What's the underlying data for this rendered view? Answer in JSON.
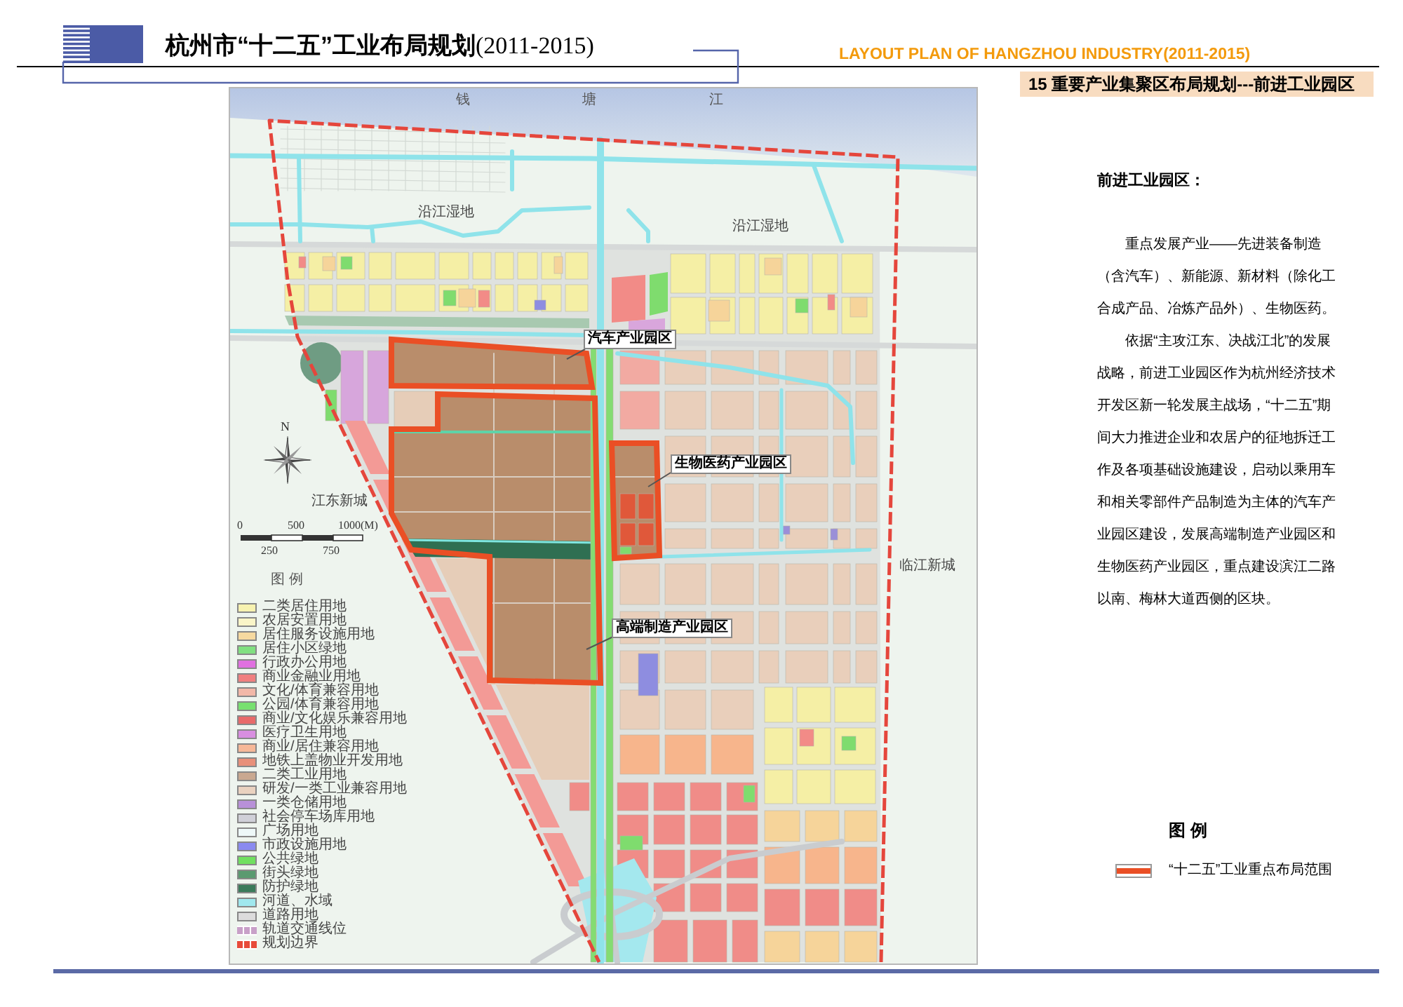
{
  "header": {
    "title": "杭州市“十二五”工业布局规划",
    "title_period": "(2011-2015)",
    "english_title": "LAYOUT PLAN OF HANGZHOU INDUSTRY(2011-2015)",
    "section_title": "15 重要产业集聚区布局规划---前进工业园区"
  },
  "map": {
    "river_label": "钱 塘 江",
    "area_labels": [
      {
        "text": "沿江湿地"
      },
      {
        "text": "沿江湿地"
      },
      {
        "text": "江东新城"
      },
      {
        "text": "临江新城"
      }
    ],
    "park_labels": [
      "汽车产业园区",
      "生物医药产业园区",
      "高端制造产业园区"
    ],
    "compass": {
      "north_label": "N"
    },
    "scale_bar": {
      "top_labels": [
        "0",
        "500",
        "1000(M)"
      ],
      "bottom_labels": [
        "250",
        "750"
      ]
    },
    "legend": {
      "title": "图 例",
      "items": [
        {
          "label": "二类居住用地",
          "kind": "fill",
          "color": "#f7f2b0"
        },
        {
          "label": "农居安置用地",
          "kind": "fill",
          "color": "#faf5c8"
        },
        {
          "label": "居住服务设施用地",
          "kind": "fill",
          "color": "#f6d9a0"
        },
        {
          "label": "居住小区绿地",
          "kind": "fill",
          "color": "#80e080"
        },
        {
          "label": "行政办公用地",
          "kind": "fill",
          "color": "#e070e0"
        },
        {
          "label": "商业金融业用地",
          "kind": "fill",
          "color": "#f07f7f"
        },
        {
          "label": "文化/体育兼容用地",
          "kind": "fill",
          "color": "#f2b8a8"
        },
        {
          "label": "公园/体育兼容用地",
          "kind": "fill",
          "color": "#78e070"
        },
        {
          "label": "商业/文化娱乐兼容用地",
          "kind": "fill",
          "color": "#e86a6a"
        },
        {
          "label": "医疗卫生用地",
          "kind": "fill",
          "color": "#d88ee0"
        },
        {
          "label": "商业/居住兼容用地",
          "kind": "fill",
          "color": "#f6b898"
        },
        {
          "label": "地铁上盖物业开发用地",
          "kind": "fill",
          "color": "#e8907a"
        },
        {
          "label": "二类工业用地",
          "kind": "fill",
          "color": "#c9a890"
        },
        {
          "label": "研发/一类工业兼容用地",
          "kind": "fill",
          "color": "#ead2c0"
        },
        {
          "label": "一类仓储用地",
          "kind": "fill",
          "color": "#b890d8"
        },
        {
          "label": "社会停车场库用地",
          "kind": "fill",
          "color": "#d0d0d8"
        },
        {
          "label": "广场用地",
          "kind": "fill",
          "color": "#eef8f8"
        },
        {
          "label": "市政设施用地",
          "kind": "fill",
          "color": "#8a8af0"
        },
        {
          "label": "公共绿地",
          "kind": "fill",
          "color": "#70e060"
        },
        {
          "label": "街头绿地",
          "kind": "fill",
          "color": "#5a9a70"
        },
        {
          "label": "防护绿地",
          "kind": "fill",
          "color": "#3a7a5a"
        },
        {
          "label": "河道、水域",
          "kind": "fill",
          "color": "#a0e8ee"
        },
        {
          "label": "道路用地",
          "kind": "fill",
          "color": "#dcdcdc"
        },
        {
          "label": "轨道交通线位",
          "kind": "dash",
          "color": "#c8a0c8"
        },
        {
          "label": "规划边界",
          "kind": "dash",
          "color": "#e84a3a"
        }
      ]
    }
  },
  "description": {
    "heading": "前进工业园区：",
    "paragraphs": [
      "重点发展产业——先进装备制造（含汽车）、新能源、新材料（除化工合成产品、冶炼产品外）、生物医药。",
      "依据“主攻江东、决战江北”的发展战略，前进工业园区作为杭州经济技术开发区新一轮发展主战场，“十二五”期间大力推进企业和农居户的征地拆迁工作及各项基础设施建设，启动以乘用车和相关零部件产品制造为主体的汽车产业园区建设，发展高端制造产业园区和生物医药产业园区，重点建设滨江二路以南、梅林大道西侧的区块。"
    ]
  },
  "side_legend": {
    "title": "图 例",
    "items": [
      {
        "label": "“十二五”工业重点布局范围"
      }
    ]
  }
}
